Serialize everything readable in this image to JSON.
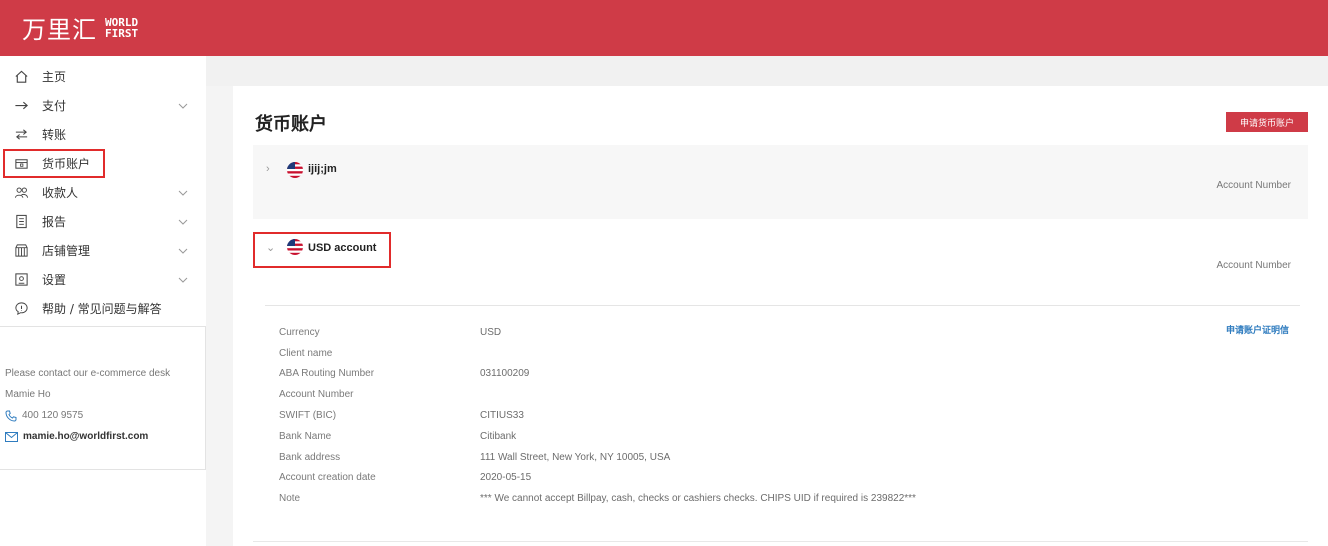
{
  "brand": {
    "name_cn": "万里汇",
    "name_en_line1": "WORLD",
    "name_en_line2": "FIRST"
  },
  "sidebar": {
    "items": [
      {
        "label": "主页",
        "icon": "home-icon",
        "has_chevron": false
      },
      {
        "label": "支付",
        "icon": "arrow-right-icon",
        "has_chevron": true
      },
      {
        "label": "转账",
        "icon": "transfer-icon",
        "has_chevron": false
      },
      {
        "label": "货币账户",
        "icon": "wallet-icon",
        "has_chevron": false,
        "highlighted": true
      },
      {
        "label": "收款人",
        "icon": "people-icon",
        "has_chevron": true
      },
      {
        "label": "报告",
        "icon": "report-icon",
        "has_chevron": true
      },
      {
        "label": "店铺管理",
        "icon": "store-icon",
        "has_chevron": true
      },
      {
        "label": "设置",
        "icon": "settings-icon",
        "has_chevron": true
      },
      {
        "label": "帮助 / 常见问题与解答",
        "icon": "help-icon",
        "has_chevron": false
      }
    ]
  },
  "contact": {
    "intro": "Please contact our e-commerce desk",
    "name": "Mamie Ho",
    "phone": "400 120 9575",
    "email": "mamie.ho@worldfirst.com"
  },
  "main": {
    "title": "货币账户",
    "apply_button": "申请货币账户",
    "accounts": [
      {
        "name": "ijij;jm",
        "account_number_label": "Account Number",
        "expanded": false
      },
      {
        "name": "USD account",
        "account_number_label": "Account Number",
        "expanded": true
      }
    ],
    "certificate_link": "申请账户证明信",
    "details": [
      {
        "label": "Currency",
        "value": "USD"
      },
      {
        "label": "Client name",
        "value": ""
      },
      {
        "label": "ABA Routing Number",
        "value": "031100209"
      },
      {
        "label": "Account Number",
        "value": ""
      },
      {
        "label": "SWIFT (BIC)",
        "value": "CITIUS33"
      },
      {
        "label": "Bank Name",
        "value": "Citibank"
      },
      {
        "label": "Bank address",
        "value": "111 Wall Street, New York, NY 10005, USA"
      },
      {
        "label": "Account creation date",
        "value": "2020-05-15"
      },
      {
        "label": "Note",
        "value": "*** We cannot accept Billpay, cash, checks or cashiers checks. CHIPS UID if required is 239822***"
      }
    ]
  },
  "colors": {
    "brand_red": "#cf3b47",
    "highlight_red": "#e12b2b",
    "link_blue": "#2f7cbf"
  }
}
